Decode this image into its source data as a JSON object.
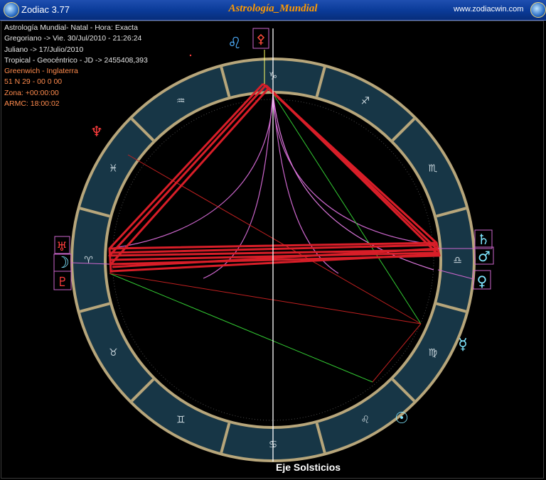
{
  "window": {
    "app_name": "Zodiac 3.77",
    "title": "Astrología_Mundial",
    "url": "www.zodiacwin.com"
  },
  "info": {
    "line1": "Astrología Mundial- Natal - Hora: Exacta",
    "line2": "Gregoriano -> Vie. 30/Jul/2010 - 21:26:24",
    "line3": "Juliano -> 17/Julio/2010",
    "line4": "Tropical - Geocéntrico - JD -> 2455408,393",
    "line5": "Greenwich - Inglaterra",
    "line6": "51 N 29 - 00 0 00",
    "line7": "Zona: +00:00:00",
    "line8": "ARMC: 18:00:02"
  },
  "chart": {
    "axis_label": "Eje Solsticios",
    "signs": [
      {
        "name": "sagittarius",
        "glyph": "♐"
      },
      {
        "name": "scorpio",
        "glyph": "♏"
      },
      {
        "name": "libra",
        "glyph": "♎"
      },
      {
        "name": "virgo",
        "glyph": "♍"
      },
      {
        "name": "leo",
        "glyph": "♌"
      },
      {
        "name": "cancer",
        "glyph": "♋"
      },
      {
        "name": "gemini",
        "glyph": "♊"
      },
      {
        "name": "taurus",
        "glyph": "♉"
      },
      {
        "name": "aries",
        "glyph": "♈"
      },
      {
        "name": "pisces",
        "glyph": "♓"
      },
      {
        "name": "aquarius",
        "glyph": "♒"
      },
      {
        "name": "capricorn",
        "glyph": "♑"
      }
    ],
    "planets": [
      {
        "name": "part-of-fortune",
        "glyph": "⚴",
        "color": "#ff4a3a",
        "boxed": true
      },
      {
        "name": "leo-marker",
        "glyph": "♌",
        "color": "#4fb0ff",
        "boxed": false
      },
      {
        "name": "neptune",
        "glyph": "♆",
        "color": "#ff3d3d",
        "boxed": false
      },
      {
        "name": "uranus",
        "glyph": "♅",
        "color": "#ff3d3d",
        "boxed": true
      },
      {
        "name": "moon",
        "glyph": "☽",
        "color": "#7fe6ff",
        "boxed": true
      },
      {
        "name": "pluto",
        "glyph": "♇",
        "color": "#ff3d3d",
        "boxed": true
      },
      {
        "name": "saturn",
        "glyph": "♄",
        "color": "#7fe6ff",
        "boxed": true
      },
      {
        "name": "mars",
        "glyph": "♂",
        "color": "#7fe6ff",
        "boxed": true
      },
      {
        "name": "venus",
        "glyph": "♀",
        "color": "#7fe6ff",
        "boxed": true
      },
      {
        "name": "mercury",
        "glyph": "☿",
        "color": "#7fe6ff",
        "boxed": false
      },
      {
        "name": "sun",
        "glyph": "☉",
        "color": "#7fe6ff",
        "boxed": false
      }
    ],
    "colors": {
      "ring_fill": "#173646",
      "ring_border": "#b7a67b",
      "aspect_red": "#d81e28",
      "curve_pink": "#cc66cc",
      "axis_white": "#ffffff",
      "box_border": "#cc66cc"
    }
  }
}
